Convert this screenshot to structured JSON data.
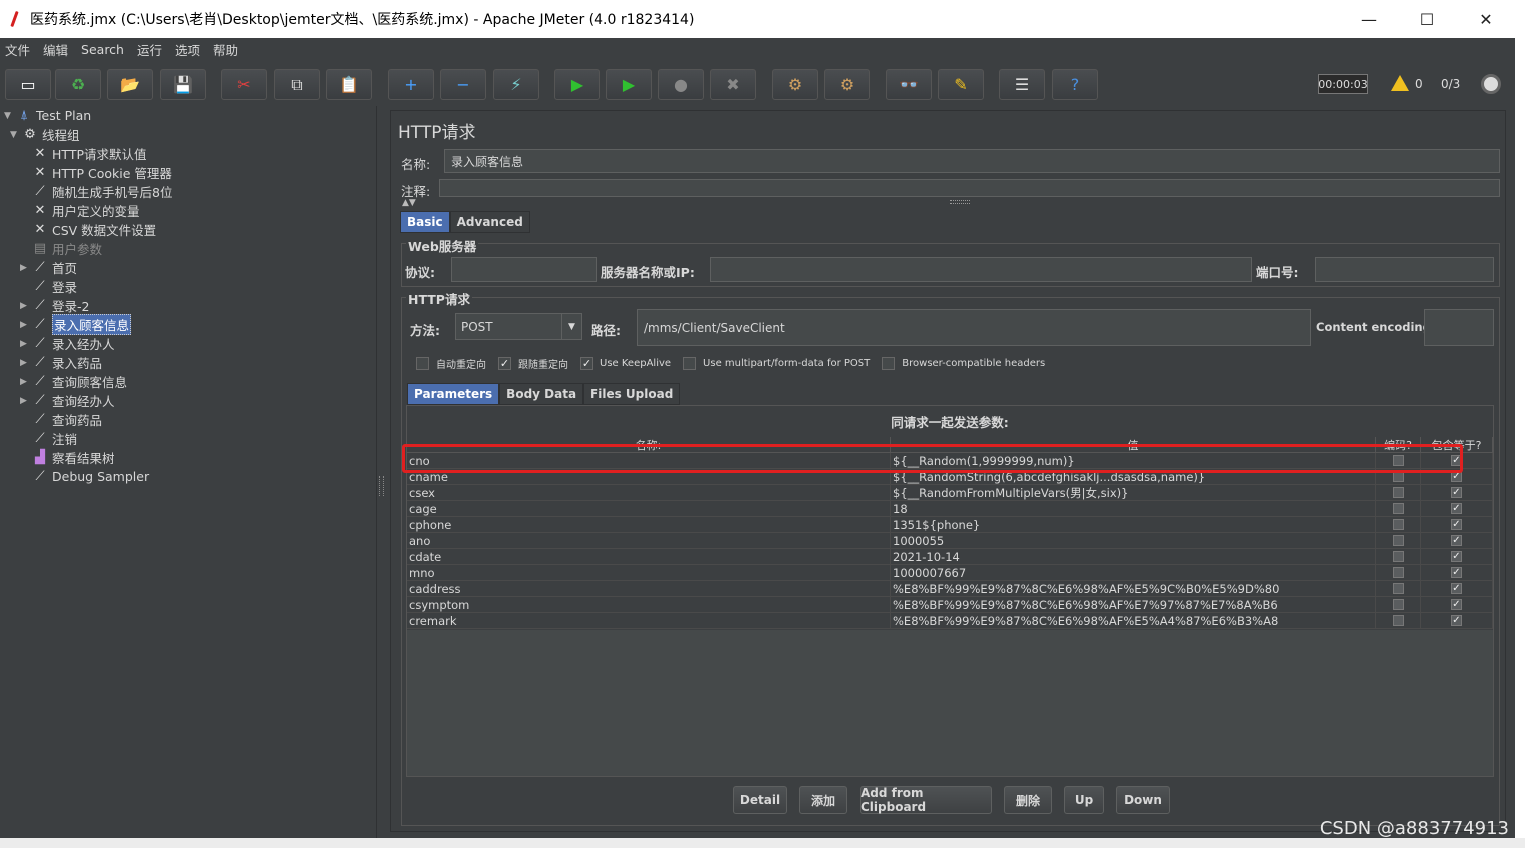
{
  "window": {
    "title": "医药系统.jmx (C:\\Users\\老肖\\Desktop\\jemter文档、\\医药系统.jmx) - Apache JMeter (4.0 r1823414)",
    "minimize": "—",
    "maximize": "☐",
    "close": "✕"
  },
  "menu": [
    "文件",
    "编辑",
    "Search",
    "运行",
    "选项",
    "帮助"
  ],
  "toolbar": {
    "buttons": [
      {
        "name": "new-icon",
        "glyph": "▭",
        "color": "#ffffff"
      },
      {
        "name": "templates-icon",
        "glyph": "♻",
        "color": "#4caf50"
      },
      {
        "name": "open-icon",
        "glyph": "📂",
        "color": "#f0b030"
      },
      {
        "name": "save-icon",
        "glyph": "💾",
        "color": "#cccccc"
      },
      {
        "name": "cut-icon",
        "glyph": "✂",
        "color": "#e04040"
      },
      {
        "name": "copy-icon",
        "glyph": "⧉",
        "color": "#dddddd"
      },
      {
        "name": "paste-icon",
        "glyph": "📋",
        "color": "#dddddd"
      },
      {
        "name": "expand-icon",
        "glyph": "+",
        "color": "#4aa0ff"
      },
      {
        "name": "collapse-icon",
        "glyph": "−",
        "color": "#4aa0ff"
      },
      {
        "name": "toggle-icon",
        "glyph": "⚡",
        "color": "#7cc"
      },
      {
        "name": "start-icon",
        "glyph": "▶",
        "color": "#30c030"
      },
      {
        "name": "start-no-pause-icon",
        "glyph": "▶",
        "color": "#30c030"
      },
      {
        "name": "stop-icon",
        "glyph": "●",
        "color": "#888888"
      },
      {
        "name": "shutdown-icon",
        "glyph": "✖",
        "color": "#888888"
      },
      {
        "name": "clear-icon",
        "glyph": "⚙",
        "color": "#d0a060"
      },
      {
        "name": "clear-all-icon",
        "glyph": "⚙",
        "color": "#d0a060"
      },
      {
        "name": "search-icon",
        "glyph": "👓",
        "color": "#dddddd"
      },
      {
        "name": "reset-search-icon",
        "glyph": "✎",
        "color": "#f0c020"
      },
      {
        "name": "function-helper-icon",
        "glyph": "☰",
        "color": "#dddddd"
      },
      {
        "name": "help-icon",
        "glyph": "?",
        "color": "#4a90e0"
      }
    ],
    "timer": "00:00:03",
    "warnings": "0",
    "threads": "0/3"
  },
  "tree": {
    "items": [
      {
        "label": "Test Plan",
        "level": 0,
        "arrow": "▼",
        "icon": "⍋",
        "color": "#7cb0ff",
        "icon_name": "test-plan-icon"
      },
      {
        "label": "线程组",
        "level": 1,
        "arrow": "▼",
        "icon": "⚙",
        "color": "#dddddd",
        "icon_name": "thread-group-icon"
      },
      {
        "label": "HTTP请求默认值",
        "level": 2,
        "arrow": "",
        "icon": "✕",
        "color": "#dddddd",
        "icon_name": "config-icon"
      },
      {
        "label": "HTTP Cookie 管理器",
        "level": 2,
        "arrow": "",
        "icon": "✕",
        "color": "#dddddd",
        "icon_name": "config-icon"
      },
      {
        "label": "随机生成手机号后8位",
        "level": 2,
        "arrow": "",
        "icon": "⟋",
        "color": "#dddddd",
        "icon_name": "sampler-icon"
      },
      {
        "label": "用户定义的变量",
        "level": 2,
        "arrow": "",
        "icon": "✕",
        "color": "#dddddd",
        "icon_name": "config-icon"
      },
      {
        "label": "CSV 数据文件设置",
        "level": 2,
        "arrow": "",
        "icon": "✕",
        "color": "#dddddd",
        "icon_name": "config-icon"
      },
      {
        "label": "用户参数",
        "level": 2,
        "arrow": "",
        "icon": "▤",
        "color": "#888888",
        "icon_name": "preprocessor-icon",
        "disabled": true
      },
      {
        "label": "首页",
        "level": 2,
        "arrow": "▶",
        "icon": "⟋",
        "color": "#dddddd",
        "icon_name": "sampler-icon"
      },
      {
        "label": "登录",
        "level": 2,
        "arrow": "",
        "icon": "⟋",
        "color": "#dddddd",
        "icon_name": "sampler-icon"
      },
      {
        "label": "登录-2",
        "level": 2,
        "arrow": "▶",
        "icon": "⟋",
        "color": "#dddddd",
        "icon_name": "sampler-icon"
      },
      {
        "label": "录入顾客信息",
        "level": 2,
        "arrow": "▶",
        "icon": "⟋",
        "color": "#dddddd",
        "icon_name": "sampler-icon",
        "selected": true
      },
      {
        "label": "录入经办人",
        "level": 2,
        "arrow": "▶",
        "icon": "⟋",
        "color": "#dddddd",
        "icon_name": "sampler-icon"
      },
      {
        "label": "录入药品",
        "level": 2,
        "arrow": "▶",
        "icon": "⟋",
        "color": "#dddddd",
        "icon_name": "sampler-icon"
      },
      {
        "label": "查询顾客信息",
        "level": 2,
        "arrow": "▶",
        "icon": "⟋",
        "color": "#dddddd",
        "icon_name": "sampler-icon"
      },
      {
        "label": "查询经办人",
        "level": 2,
        "arrow": "▶",
        "icon": "⟋",
        "color": "#dddddd",
        "icon_name": "sampler-icon"
      },
      {
        "label": "查询药品",
        "level": 2,
        "arrow": "",
        "icon": "⟋",
        "color": "#dddddd",
        "icon_name": "sampler-icon"
      },
      {
        "label": "注销",
        "level": 2,
        "arrow": "",
        "icon": "⟋",
        "color": "#dddddd",
        "icon_name": "sampler-icon"
      },
      {
        "label": "察看结果树",
        "level": 2,
        "arrow": "",
        "icon": "▟",
        "color": "#c080e0",
        "icon_name": "listener-icon"
      },
      {
        "label": "Debug Sampler",
        "level": 2,
        "arrow": "",
        "icon": "⟋",
        "color": "#dddddd",
        "icon_name": "sampler-icon"
      }
    ]
  },
  "panel": {
    "title": "HTTP请求",
    "name_label": "名称:",
    "name_value": "录入顾客信息",
    "comment_label": "注释:",
    "comment_value": "",
    "tabs": [
      "Basic",
      "Advanced"
    ],
    "web_server": {
      "title": "Web服务器",
      "protocol_label": "协议:",
      "protocol_value": "",
      "server_label": "服务器名称或IP:",
      "server_value": "",
      "port_label": "端口号:",
      "port_value": ""
    },
    "http_request": {
      "title": "HTTP请求",
      "method_label": "方法:",
      "method_value": "POST",
      "path_label": "路径:",
      "path_value": "/mms/Client/SaveClient",
      "encoding_label": "Content encoding:",
      "encoding_value": ""
    },
    "options": [
      {
        "label": "自动重定向",
        "checked": false
      },
      {
        "label": "跟随重定向",
        "checked": true
      },
      {
        "label": "Use KeepAlive",
        "checked": true
      },
      {
        "label": "Use multipart/form-data for POST",
        "checked": false
      },
      {
        "label": "Browser-compatible headers",
        "checked": false
      }
    ],
    "sub_tabs": [
      "Parameters",
      "Body Data",
      "Files Upload"
    ],
    "params_caption": "同请求一起发送参数:",
    "table": {
      "headers": [
        "名称:",
        "值",
        "编码?",
        "包含等于?"
      ],
      "rows": [
        [
          "cno",
          "${__Random(1,9999999,num)}"
        ],
        [
          "cname",
          "${__RandomString(6,abcdefghisaklj...dsasdsa,name)}"
        ],
        [
          "csex",
          "${__RandomFromMultipleVars(男|女,six)}"
        ],
        [
          "cage",
          "18"
        ],
        [
          "cphone",
          "1351${phone}"
        ],
        [
          "ano",
          "1000055"
        ],
        [
          "cdate",
          "2021-10-14"
        ],
        [
          "mno",
          "1000007667"
        ],
        [
          "caddress",
          "%E8%BF%99%E9%87%8C%E6%98%AF%E5%9C%B0%E5%9D%80"
        ],
        [
          "csymptom",
          "%E8%BF%99%E9%87%8C%E6%98%AF%E7%97%87%E7%8A%B6"
        ],
        [
          "cremark",
          "%E8%BF%99%E9%87%8C%E6%98%AF%E5%A4%87%E6%B3%A8"
        ]
      ]
    },
    "buttons": [
      "Detail",
      "添加",
      "Add from Clipboard",
      "删除",
      "Up",
      "Down"
    ]
  },
  "watermark": "CSDN @a883774913"
}
